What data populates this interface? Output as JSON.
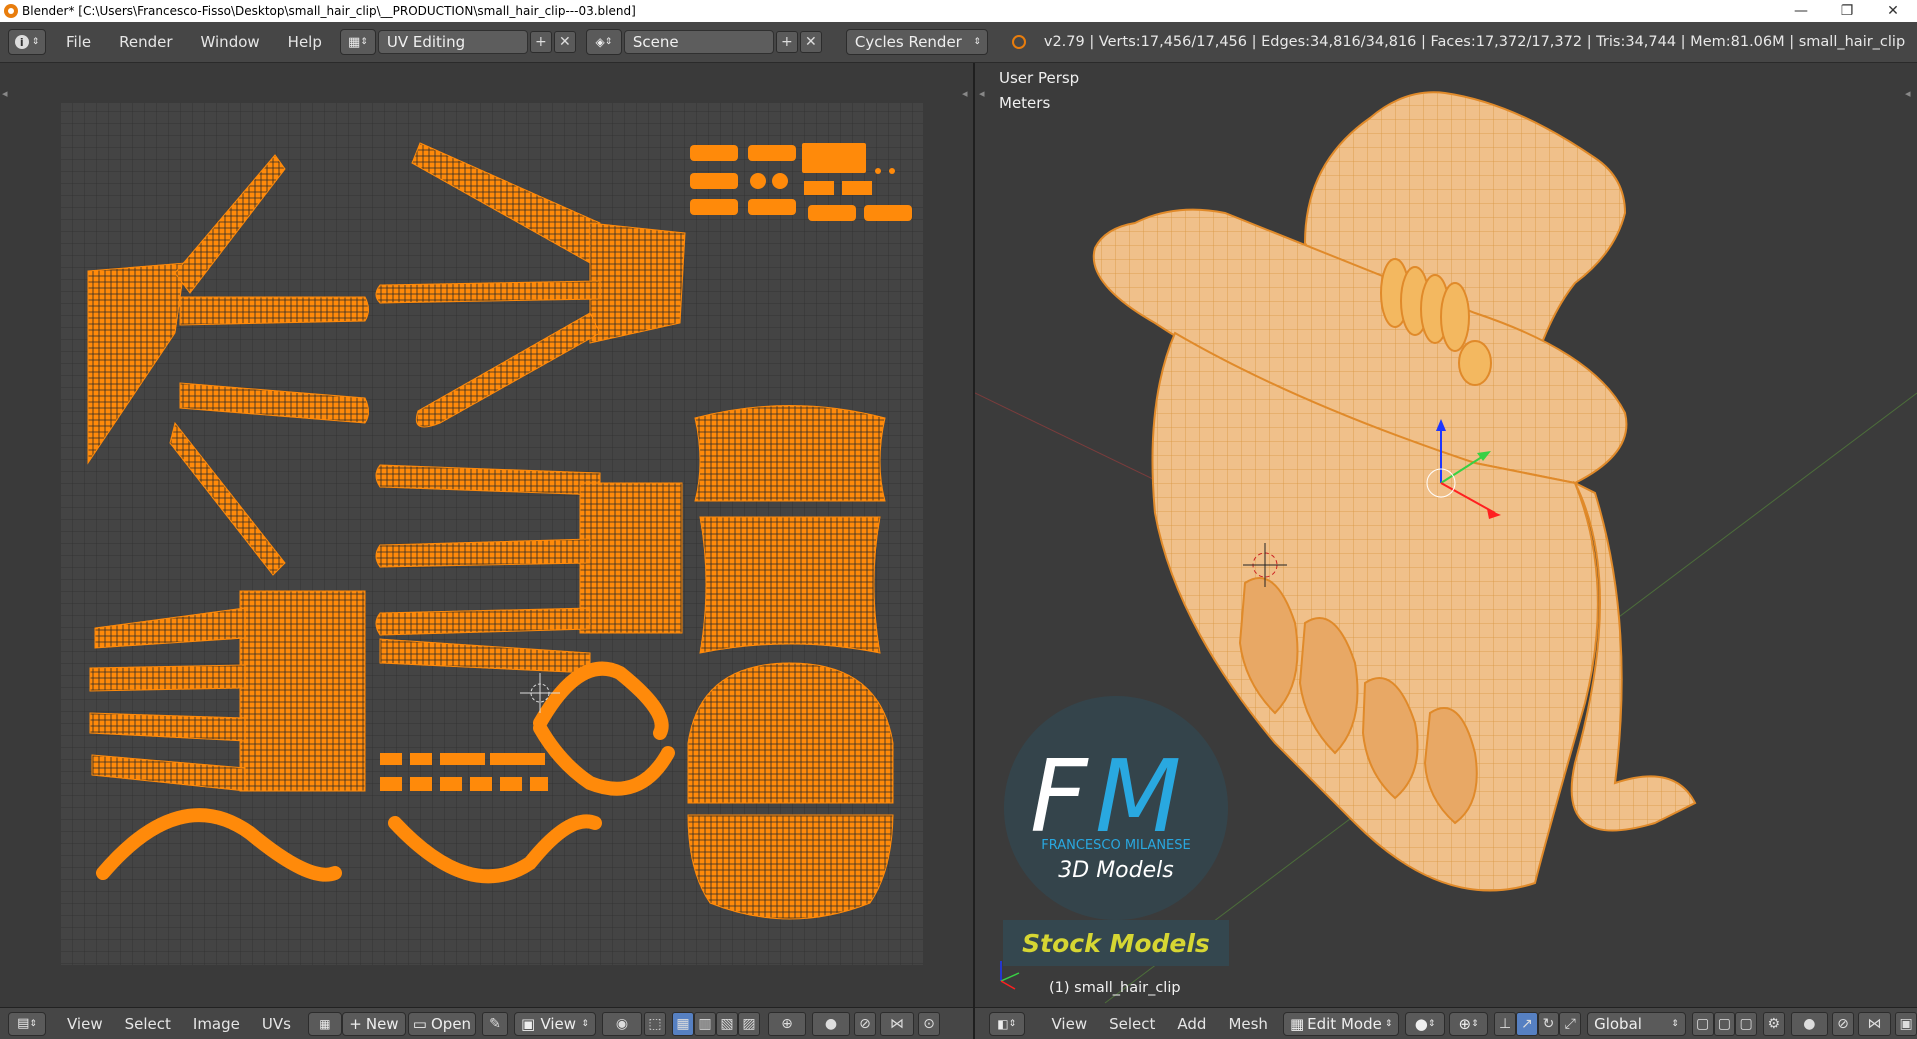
{
  "window": {
    "title": "Blender* [C:\\Users\\Francesco-Fisso\\Desktop\\small_hair_clip\\__PRODUCTION\\small_hair_clip---03.blend]",
    "minimize": "—",
    "restore": "❐",
    "close": "✕"
  },
  "menu": {
    "items": [
      "File",
      "Render",
      "Window",
      "Help"
    ],
    "layout": "UV Editing",
    "scene": "Scene",
    "engine": "Cycles Render",
    "stats": "v2.79 | Verts:17,456/17,456 | Edges:34,816/34,816 | Faces:17,372/17,372 | Tris:34,744 | Mem:81.06M | small_hair_clip"
  },
  "viewport": {
    "view_name": "User Persp",
    "units": "Meters",
    "object_label": "(1) small_hair_clip"
  },
  "watermark": {
    "letters": "FM",
    "name": "FRANCESCO MILANESE",
    "subtitle": "3D Models",
    "stock": "Stock Models"
  },
  "uv_bottom": {
    "items": [
      "View",
      "Select",
      "Image",
      "UVs"
    ],
    "new_label": "New",
    "open_label": "Open",
    "view_label": "View"
  },
  "vp_bottom": {
    "items": [
      "View",
      "Select",
      "Add",
      "Mesh"
    ],
    "mode": "Edit Mode",
    "orientation": "Global"
  },
  "colors": {
    "accent": "#ff8a0a",
    "mesh": "#f2c28a",
    "stock_text": "#d6d633"
  }
}
